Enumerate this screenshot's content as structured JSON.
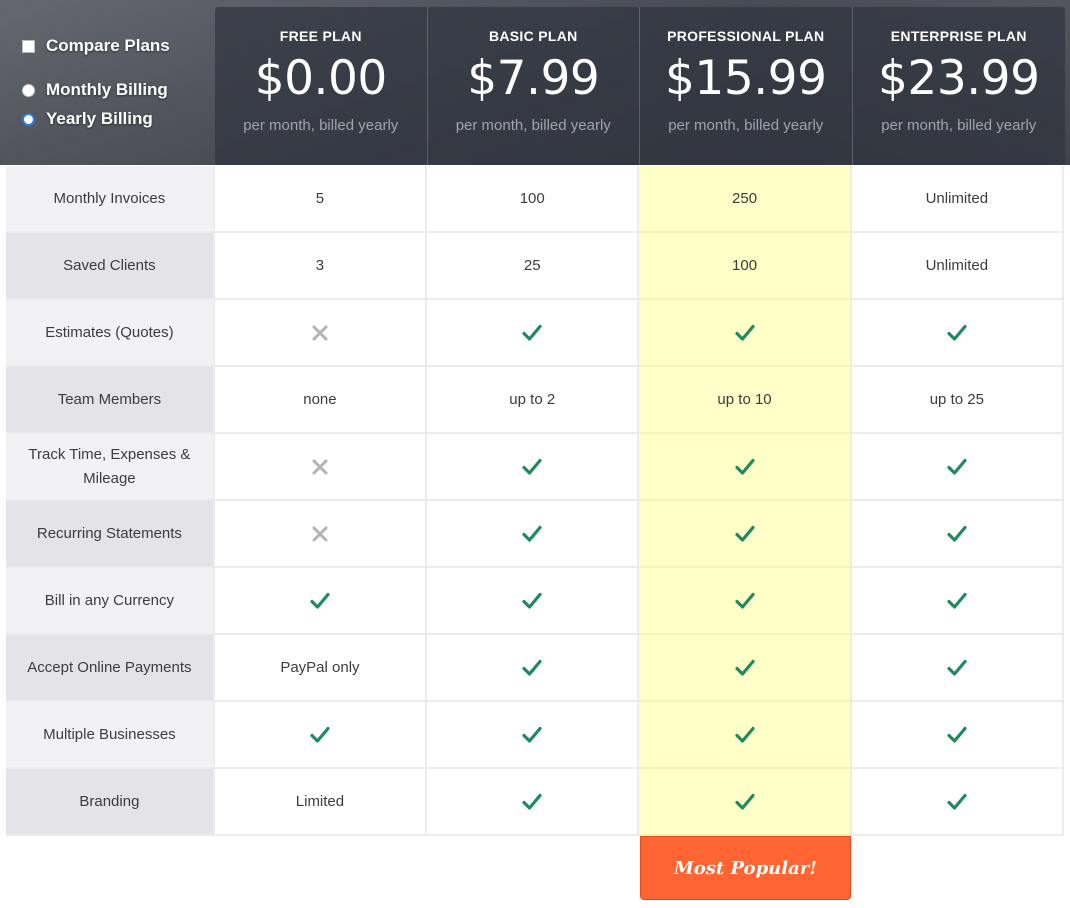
{
  "controls": {
    "compare_label": "Compare Plans",
    "monthly_label": "Monthly Billing",
    "yearly_label": "Yearly Billing",
    "selected_billing": "yearly"
  },
  "plans": [
    {
      "name": "FREE PLAN",
      "price": "$0.00",
      "period": "per month, billed yearly"
    },
    {
      "name": "BASIC PLAN",
      "price": "$7.99",
      "period": "per month, billed yearly"
    },
    {
      "name": "PROFESSIONAL PLAN",
      "price": "$15.99",
      "period": "per month, billed yearly"
    },
    {
      "name": "ENTERPRISE PLAN",
      "price": "$23.99",
      "period": "per month, billed yearly"
    }
  ],
  "highlighted_plan": "PROFESSIONAL PLAN",
  "colors": {
    "highlight": "#ffffc7",
    "check": "#1f8a5e",
    "cross": "#b3b3b3",
    "popular_badge": "#ff6433",
    "radio_selected": "#2b7bd6"
  },
  "features": [
    {
      "label": "Monthly Invoices",
      "values": [
        "5",
        "100",
        "250",
        "Unlimited"
      ]
    },
    {
      "label": "Saved Clients",
      "values": [
        "3",
        "25",
        "100",
        "Unlimited"
      ]
    },
    {
      "label": "Estimates (Quotes)",
      "values": [
        "cross-icon",
        "check-icon",
        "check-icon",
        "check-icon"
      ]
    },
    {
      "label": "Team Members",
      "values": [
        "none",
        "up to 2",
        "up to 10",
        "up to 25"
      ]
    },
    {
      "label": "Track Time, Expenses & Mileage",
      "values": [
        "cross-icon",
        "check-icon",
        "check-icon",
        "check-icon"
      ]
    },
    {
      "label": "Recurring Statements",
      "values": [
        "cross-icon",
        "check-icon",
        "check-icon",
        "check-icon"
      ]
    },
    {
      "label": "Bill in any Currency",
      "values": [
        "check-icon",
        "check-icon",
        "check-icon",
        "check-icon"
      ]
    },
    {
      "label": "Accept Online Payments",
      "values": [
        "PayPal only",
        "check-icon",
        "check-icon",
        "check-icon"
      ]
    },
    {
      "label": "Multiple Businesses",
      "values": [
        "check-icon",
        "check-icon",
        "check-icon",
        "check-icon"
      ]
    },
    {
      "label": "Branding",
      "values": [
        "Limited",
        "check-icon",
        "check-icon",
        "check-icon"
      ]
    }
  ],
  "badge": {
    "label": "Most Popular!"
  }
}
